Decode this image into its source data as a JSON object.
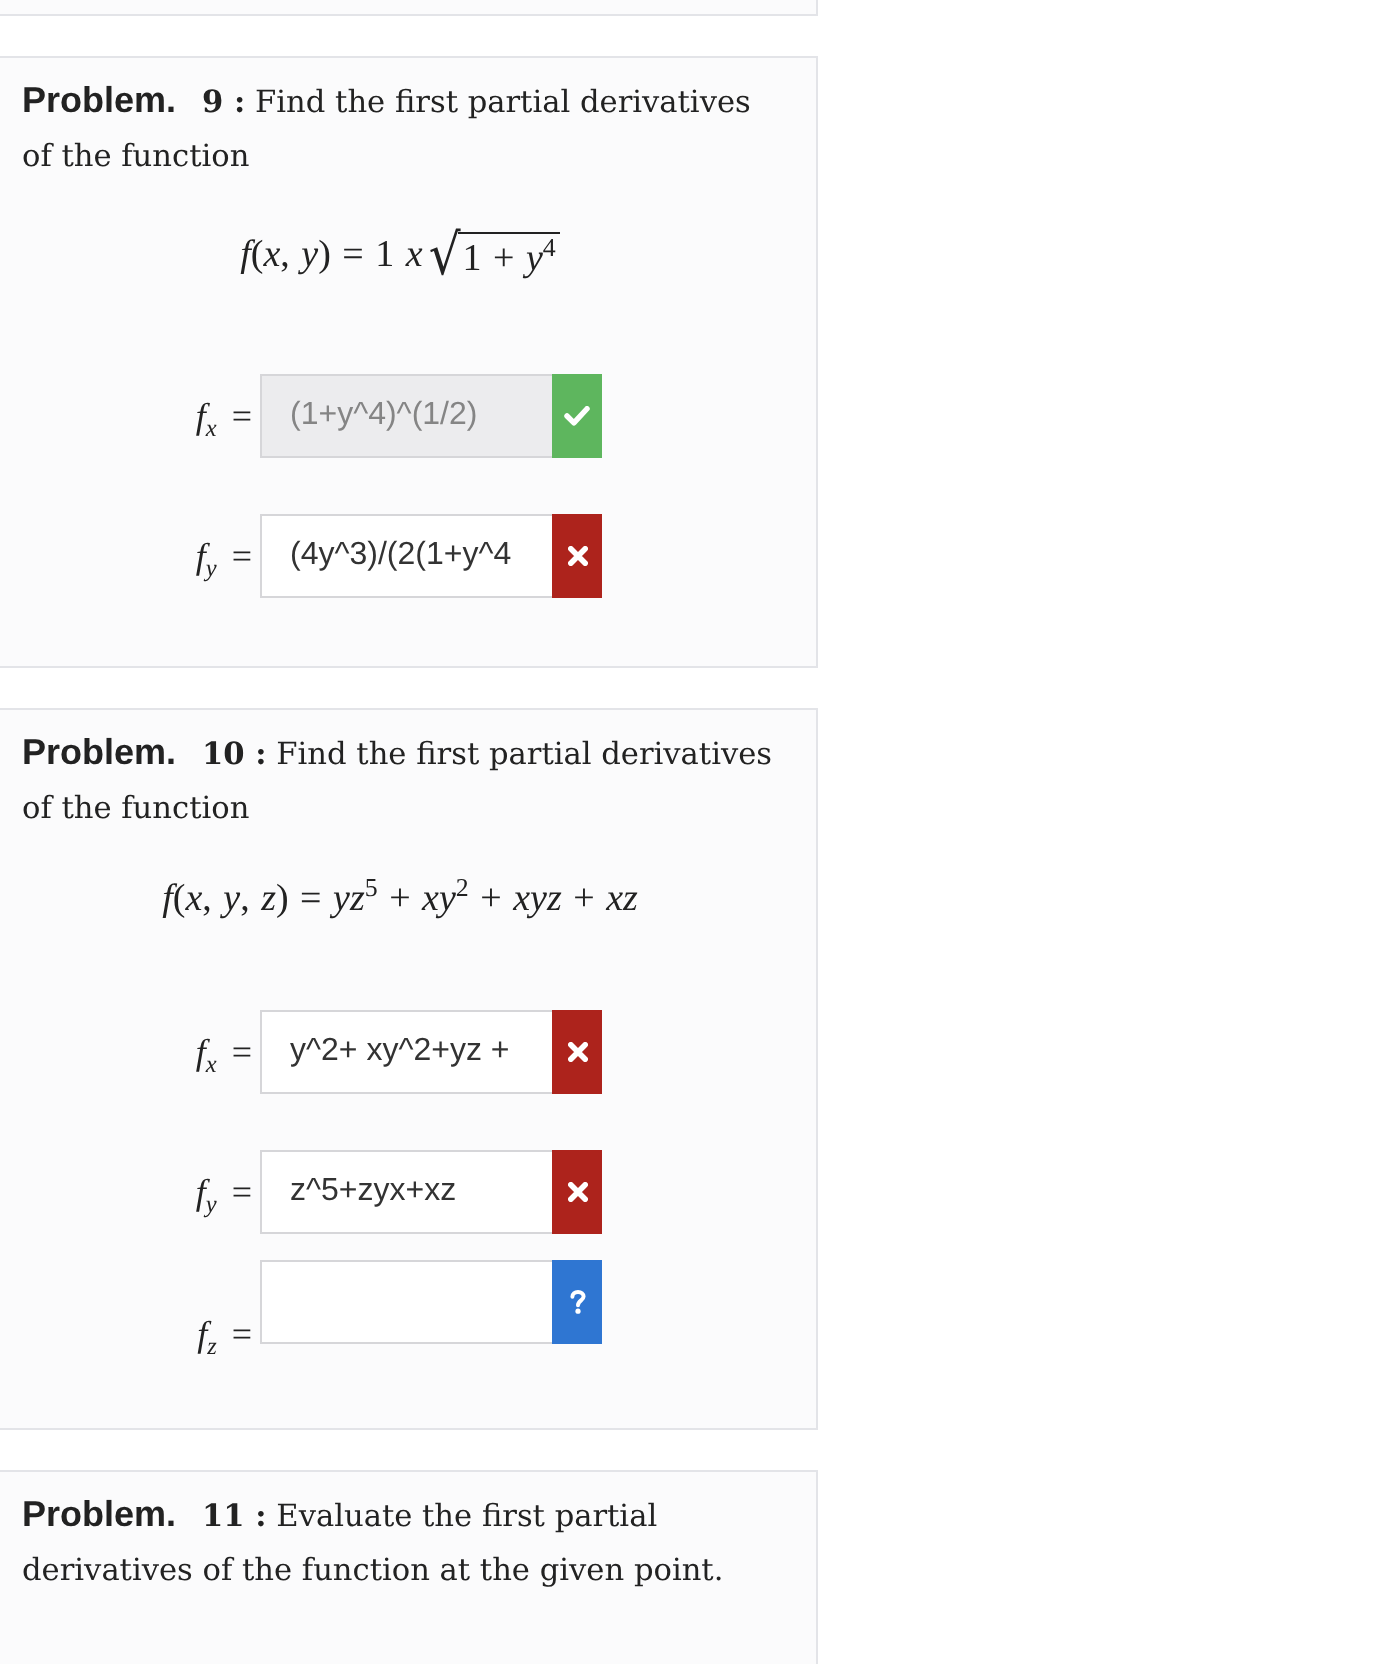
{
  "problems": [
    {
      "heading": "Problem.",
      "number": "9 :",
      "prompt": "Find the first partial derivatives of the function",
      "formula": [
        {
          "kind": "text",
          "value": "*f*(*x*, *y*) = 1 *x*"
        },
        {
          "kind": "sqrt",
          "sign": "√",
          "value": "1 + *y*$^{4}$"
        }
      ],
      "answers": [
        {
          "label": "*f*$_{x}$ =",
          "value": "(1+y^4)^(1/2)",
          "disabled": true,
          "answered": true,
          "correct": true
        },
        {
          "label": "*f*$_{y}$ =",
          "value": "(4y^3)/(2(1+y^4",
          "disabled": false,
          "answered": true,
          "correct": false
        }
      ]
    },
    {
      "heading": "Problem.",
      "number": "10 :",
      "prompt": "Find the first partial derivatives of the function",
      "formula": [
        {
          "kind": "text",
          "value": "*f*(*x*, *y*, *z*) = *yz*$^{5}$ + *xy*$^{2}$ + *xyz* + *xz*"
        }
      ],
      "answers": [
        {
          "label": "*f*$_{x}$ =",
          "value": "y^2+ xy^2+yz +",
          "disabled": false,
          "answered": true,
          "correct": false
        },
        {
          "label": "*f*$_{y}$ =",
          "value": "z^5+zyx+xz",
          "disabled": false,
          "answered": true,
          "correct": false
        },
        {
          "label": "*f*$_{z}$ =",
          "disabled": false,
          "answered": false
        }
      ]
    },
    {
      "heading": "Problem.",
      "number": "11 :",
      "prompt": "Evaluate the first partial derivatives of the function at the given point."
    }
  ]
}
